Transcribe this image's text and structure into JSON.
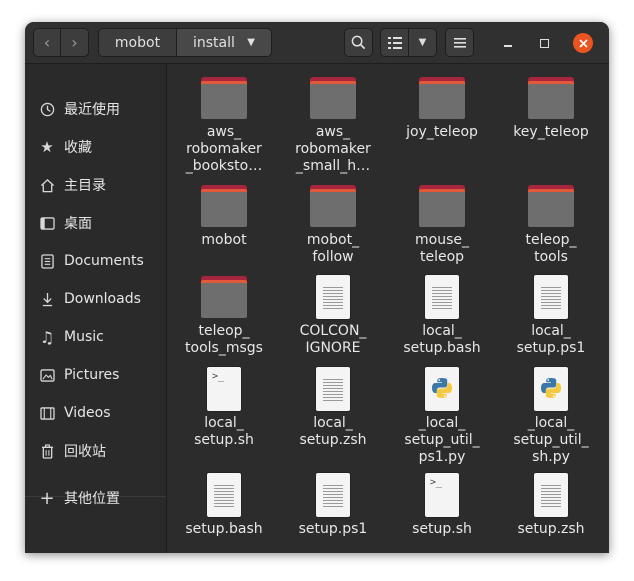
{
  "header": {
    "path": [
      "mobot",
      "install"
    ]
  },
  "sidebar": {
    "items": [
      {
        "label": "最近使用",
        "icon": "clock-icon"
      },
      {
        "label": "收藏",
        "icon": "star-icon"
      },
      {
        "label": "主目录",
        "icon": "home-icon"
      },
      {
        "label": "桌面",
        "icon": "desktop-icon"
      },
      {
        "label": "Documents",
        "icon": "document-icon"
      },
      {
        "label": "Downloads",
        "icon": "download-icon"
      },
      {
        "label": "Music",
        "icon": "music-icon"
      },
      {
        "label": "Pictures",
        "icon": "picture-icon"
      },
      {
        "label": "Videos",
        "icon": "video-icon"
      },
      {
        "label": "回收站",
        "icon": "trash-icon"
      }
    ],
    "other": {
      "label": "其他位置",
      "icon": "plus-icon"
    }
  },
  "files": [
    {
      "name": "aws_\nrobomaker\n_booksto…",
      "kind": "folder"
    },
    {
      "name": "aws_\nrobomaker\n_small_h…",
      "kind": "folder"
    },
    {
      "name": "joy_teleop",
      "kind": "folder"
    },
    {
      "name": "key_teleop",
      "kind": "folder"
    },
    {
      "name": "mobot",
      "kind": "folder"
    },
    {
      "name": "mobot_\nfollow",
      "kind": "folder"
    },
    {
      "name": "mouse_\nteleop",
      "kind": "folder"
    },
    {
      "name": "teleop_\ntools",
      "kind": "folder"
    },
    {
      "name": "teleop_\ntools_msgs",
      "kind": "folder"
    },
    {
      "name": "COLCON_\nIGNORE",
      "kind": "text"
    },
    {
      "name": "local_\nsetup.bash",
      "kind": "text"
    },
    {
      "name": "local_\nsetup.ps1",
      "kind": "text"
    },
    {
      "name": "local_\nsetup.sh",
      "kind": "script"
    },
    {
      "name": "local_\nsetup.zsh",
      "kind": "text"
    },
    {
      "name": "_local_\nsetup_util_\nps1.py",
      "kind": "python"
    },
    {
      "name": "_local_\nsetup_util_\nsh.py",
      "kind": "python"
    },
    {
      "name": "setup.bash",
      "kind": "text"
    },
    {
      "name": "setup.ps1",
      "kind": "text"
    },
    {
      "name": "setup.sh",
      "kind": "script"
    },
    {
      "name": "setup.zsh",
      "kind": "text"
    }
  ],
  "colors": {
    "folder_accent": "#e2583a",
    "close_button": "#e95420"
  }
}
